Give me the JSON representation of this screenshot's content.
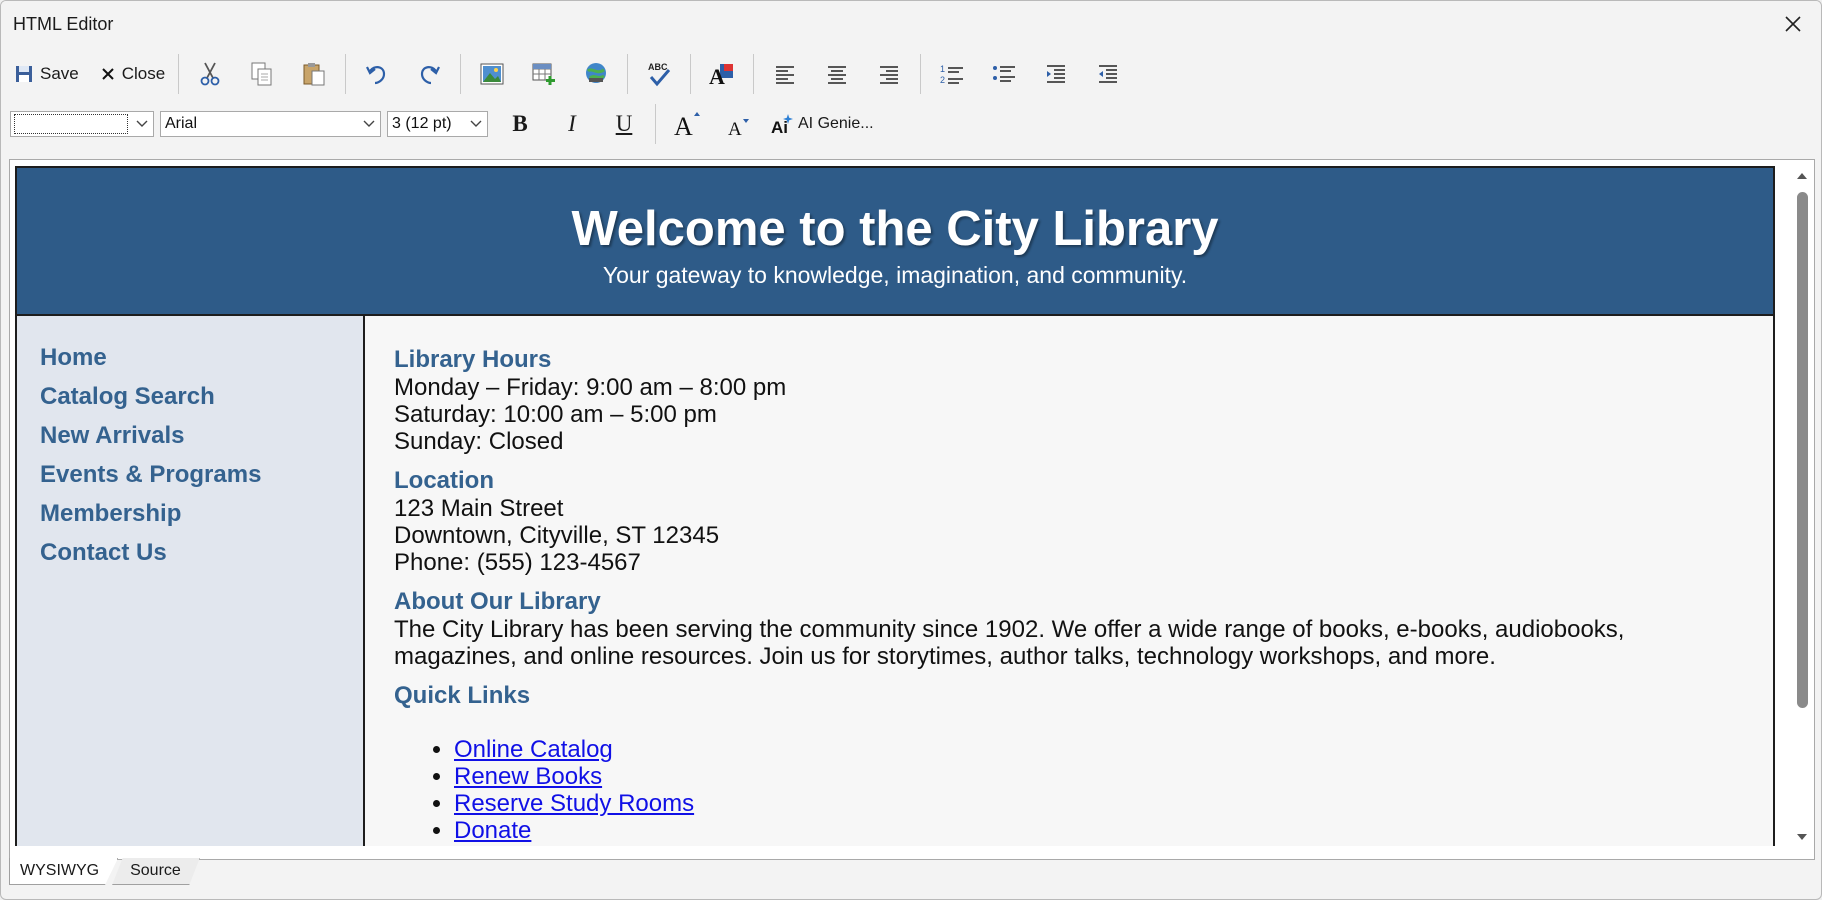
{
  "window": {
    "title": "HTML Editor"
  },
  "toolbar": {
    "save_label": "Save",
    "close_label": "Close",
    "icons": [
      "cut-icon",
      "copy-icon",
      "paste-icon",
      "undo-icon",
      "redo-icon",
      "insert-image-icon",
      "insert-table-icon",
      "insert-link-icon",
      "spellcheck-icon",
      "text-color-icon",
      "align-left-icon",
      "align-center-icon",
      "align-right-icon",
      "numbered-list-icon",
      "bullet-list-icon",
      "indent-icon",
      "outdent-icon"
    ]
  },
  "format_bar": {
    "style_value": "",
    "font_value": "Arial",
    "size_value": "3 (12 pt)",
    "ai_label": "AI Genie..."
  },
  "document": {
    "header_title": "Welcome to the City Library",
    "header_subtitle": "Your gateway to knowledge, imagination, and community.",
    "nav": [
      "Home",
      "Catalog Search",
      "New Arrivals",
      "Events & Programs",
      "Membership",
      "Contact Us"
    ],
    "hours": {
      "heading": "Library Hours",
      "lines": [
        "Monday – Friday: 9:00 am – 8:00 pm",
        "Saturday: 10:00 am – 5:00 pm",
        "Sunday: Closed"
      ]
    },
    "location": {
      "heading": "Location",
      "lines": [
        "123 Main Street",
        "Downtown, Cityville, ST 12345",
        "Phone: (555) 123-4567"
      ]
    },
    "about": {
      "heading": "About Our Library",
      "text": "The City Library has been serving the community since 1902. We offer a wide range of books, e-books, audiobooks, magazines, and online resources. Join us for storytimes, author talks, technology workshops, and more."
    },
    "quick_links": {
      "heading": "Quick Links",
      "items": [
        "Online Catalog",
        "Renew Books",
        "Reserve Study Rooms",
        "Donate"
      ]
    }
  },
  "tabs": [
    "WYSIWYG",
    "Source"
  ],
  "colors": {
    "header_bg": "#2e5b88",
    "sidebar_bg": "#e1e6ee",
    "heading": "#34628f",
    "link": "#1010e6"
  }
}
